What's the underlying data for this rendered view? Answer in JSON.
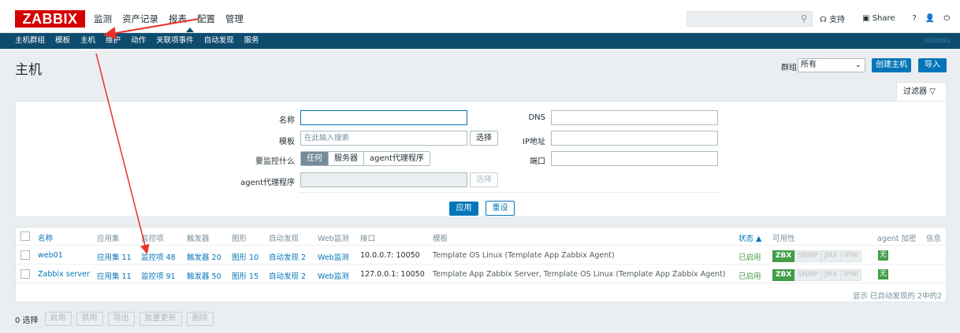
{
  "logo": "ZABBIX",
  "mainnav": [
    "监测",
    "资产记录",
    "报表",
    "配置",
    "管理"
  ],
  "toplinks": {
    "support": "支持",
    "share": "Share",
    "help": "?",
    "user": "👤",
    "logout": "⏻"
  },
  "subnav": {
    "items": [
      "主机群组",
      "模板",
      "主机",
      "维护",
      "动作",
      "关联项事件",
      "自动发现",
      "服务"
    ],
    "user": "xiaowu"
  },
  "page": {
    "title": "主机",
    "group_label": "群组",
    "group_value": "所有",
    "create_btn": "创建主机",
    "import_btn": "导入"
  },
  "filter": {
    "tab_label": "过滤器",
    "name_label": "名称",
    "name_value": "",
    "template_label": "模板",
    "template_placeholder": "在此输入搜索",
    "select_btn": "选择",
    "monitor_label": "要监控什么",
    "monitor_options": [
      "任何",
      "服务器",
      "agent代理程序"
    ],
    "proxy_label": "agent代理程序",
    "proxy_select_btn": "选择",
    "dns_label": "DNS",
    "ip_label": "IP地址",
    "port_label": "端口",
    "apply_btn": "应用",
    "reset_btn": "重设"
  },
  "table": {
    "headers": [
      "名称",
      "应用集",
      "监控项",
      "触发器",
      "图形",
      "自动发现",
      "Web监测",
      "接口",
      "模板",
      "状态 ▲",
      "可用性",
      "agent 加密",
      "信息"
    ],
    "rows": [
      {
        "name": "web01",
        "apps": "应用集 11",
        "items": "监控项 48",
        "triggers": "触发器 20",
        "graphs": "图形 10",
        "discovery": "自动发现 2",
        "web": "Web监测",
        "interface": "10.0.0.7: 10050",
        "templates": "Template OS Linux (Template App Zabbix Agent)",
        "status": "已启用",
        "avail": [
          "ZBX",
          "SNMP",
          "JMX",
          "IPMI"
        ],
        "enc": "无"
      },
      {
        "name": "Zabbix server",
        "apps": "应用集 11",
        "items": "监控项 91",
        "triggers": "触发器 50",
        "graphs": "图形 15",
        "discovery": "自动发现 2",
        "web": "Web监测",
        "interface": "127.0.0.1: 10050",
        "templates": "Template App Zabbix Server, Template OS Linux (Template App Zabbix Agent)",
        "status": "已启用",
        "avail": [
          "ZBX",
          "SNMP",
          "JMX",
          "IPMI"
        ],
        "enc": "无"
      }
    ],
    "footer": "显示 已自动发现的 2中的2"
  },
  "bottom": {
    "count": "0 选择",
    "buttons": [
      "启用",
      "禁用",
      "导出",
      "批量更新",
      "删除"
    ]
  },
  "colors": {
    "accent": "#0275b8",
    "navbar": "#0e4c6e",
    "logo": "#d40000",
    "enabled": "#429e47",
    "annotation": "#e8322b"
  }
}
